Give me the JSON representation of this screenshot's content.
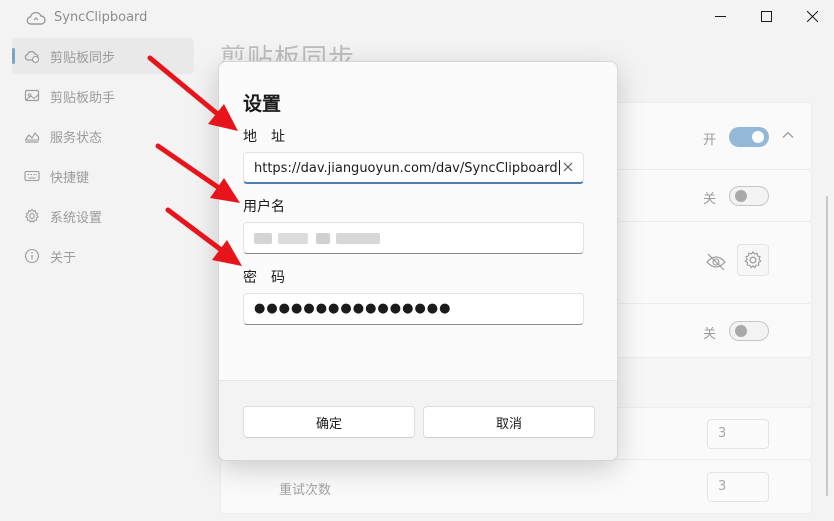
{
  "app": {
    "title": "SyncClipboard"
  },
  "sidebar": {
    "items": [
      {
        "label": "剪贴板同步",
        "icon": "clipboard-sync-icon",
        "active": true
      },
      {
        "label": "剪贴板助手",
        "icon": "clipboard-assistant-icon"
      },
      {
        "label": "服务状态",
        "icon": "chart-icon"
      },
      {
        "label": "快捷键",
        "icon": "keyboard-icon"
      },
      {
        "label": "系统设置",
        "icon": "gear-icon"
      },
      {
        "label": "关于",
        "icon": "info-icon"
      }
    ]
  },
  "main": {
    "page_title": "剪贴板同步",
    "toggle_on_text": "开",
    "toggle_off_text": "关",
    "retry_label": "重试次数",
    "num_value_1": "3",
    "num_value_2": "3"
  },
  "dialog": {
    "title": "设置",
    "address_label": "地　址",
    "address_value": "https://dav.jianguoyun.com/dav/SyncClipboard",
    "username_label": "用户名",
    "password_label": "密　码",
    "password_value": "●●●●●●●●●●●●●●●●",
    "confirm_label": "确定",
    "cancel_label": "取消"
  },
  "colors": {
    "accent": "#7aa5c8",
    "annotation_arrow": "#e8141c"
  }
}
